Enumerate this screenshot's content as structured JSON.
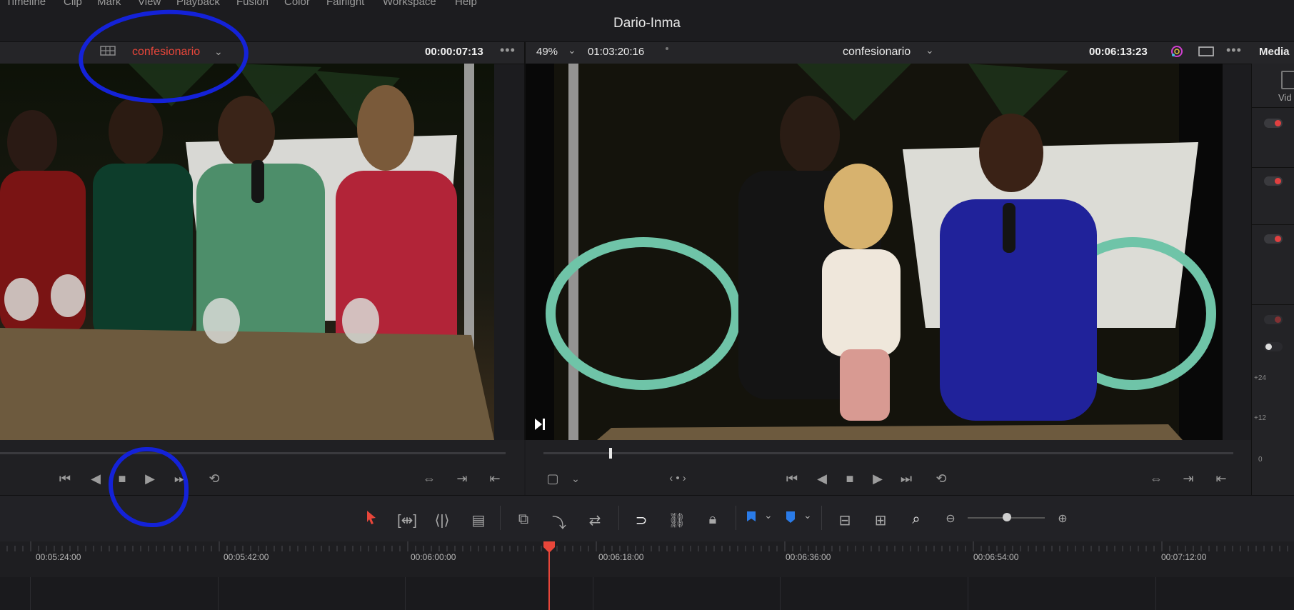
{
  "menu": [
    "Timeline",
    "Clip",
    "Mark",
    "View",
    "Playback",
    "Fusion",
    "Color",
    "Fairlight",
    "Workspace",
    "Help"
  ],
  "project_title": "Dario-Inma",
  "source_viewer": {
    "clip_name": "confesionario",
    "timecode": "00:00:07:13"
  },
  "timeline_viewer": {
    "zoom": "49%",
    "source_timecode": "01:03:20:16",
    "timeline_name": "confesionario",
    "timecode": "00:06:13:23"
  },
  "right_panel": {
    "title": "Media",
    "tab_label": "Vid",
    "meter_labels": [
      "+24",
      "+12",
      "0"
    ]
  },
  "ruler_ticks": [
    "00:05:24:00",
    "00:05:42:00",
    "00:06:00:00",
    "00:06:18:00",
    "00:06:36:00",
    "00:06:54:00",
    "00:07:12:00"
  ],
  "colors": {
    "accent_red": "#e8463a",
    "annotation_blue": "#1422d8",
    "background": "#1c1c1f"
  }
}
